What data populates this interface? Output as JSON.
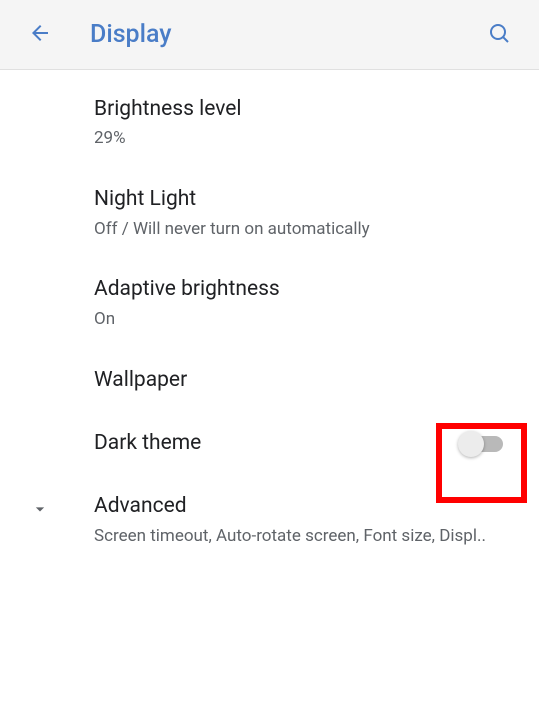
{
  "header": {
    "title": "Display"
  },
  "settings": {
    "brightness": {
      "title": "Brightness level",
      "value": "29%"
    },
    "nightLight": {
      "title": "Night Light",
      "value": "Off / Will never turn on automatically"
    },
    "adaptiveBrightness": {
      "title": "Adaptive brightness",
      "value": "On"
    },
    "wallpaper": {
      "title": "Wallpaper"
    },
    "darkTheme": {
      "title": "Dark theme"
    },
    "advanced": {
      "title": "Advanced",
      "value": "Screen timeout, Auto-rotate screen, Font size, Displ.."
    }
  }
}
